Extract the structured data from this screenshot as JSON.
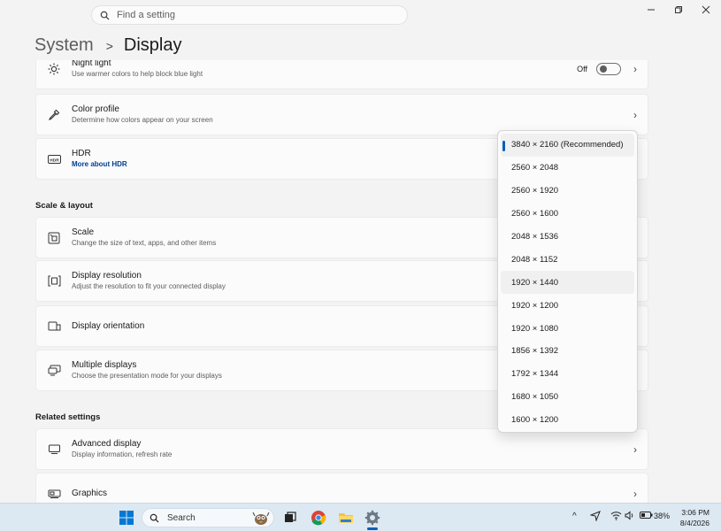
{
  "search": {
    "placeholder": "Find a setting"
  },
  "breadcrumb": {
    "parent": "System",
    "separator": ">",
    "current": "Display"
  },
  "cards": {
    "night_light": {
      "title": "Night light",
      "subtitle": "Use warmer colors to help block blue light",
      "toggle_state": "Off"
    },
    "color_profile": {
      "title": "Color profile",
      "subtitle": "Determine how colors appear on your screen"
    },
    "hdr": {
      "title": "HDR",
      "link": "More about HDR"
    },
    "scale": {
      "title": "Scale",
      "subtitle": "Change the size of text, apps, and other items"
    },
    "display_resolution": {
      "title": "Display resolution",
      "subtitle": "Adjust the resolution to fit your connected display"
    },
    "display_orientation": {
      "title": "Display orientation"
    },
    "multiple_displays": {
      "title": "Multiple displays",
      "subtitle": "Choose the presentation mode for your displays"
    },
    "advanced_display": {
      "title": "Advanced display",
      "subtitle": "Display information, refresh rate"
    },
    "graphics": {
      "title": "Graphics"
    }
  },
  "sections": {
    "scale_layout": "Scale & layout",
    "related_settings": "Related settings"
  },
  "resolution_dropdown": {
    "selected": "3840 × 2160 (Recommended)",
    "options": [
      "3840 × 2160 (Recommended)",
      "2560 × 2048",
      "2560 × 1920",
      "2560 × 1600",
      "2048 × 1536",
      "2048 × 1152",
      "1920 × 1440",
      "1920 × 1200",
      "1920 × 1080",
      "1856 × 1392",
      "1792 × 1344",
      "1680 × 1050",
      "1600 × 1200"
    ]
  },
  "taskbar": {
    "search_label": "Search",
    "battery": "38%",
    "time": "3:06 PM",
    "date": "8/4/2026"
  },
  "colors": {
    "accent": "#005fb8",
    "background": "#f3f3f3",
    "card": "#fbfbfb",
    "taskbar": "#dce8f2"
  }
}
